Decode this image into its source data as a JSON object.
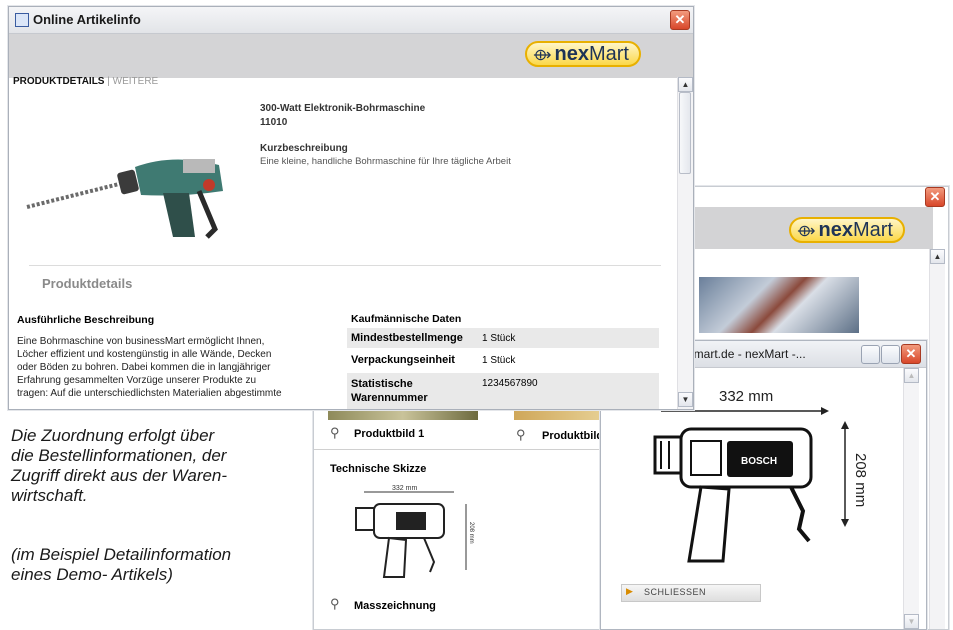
{
  "main_window": {
    "title": "Online Artikelinfo",
    "logo": {
      "bold": "nex",
      "rest": "Mart"
    },
    "tabs": {
      "active": "PRODUKTDETAILS",
      "separator": "|",
      "inactive": "WEITERE"
    },
    "product": {
      "name": "300-Watt Elektronik-Bohrmaschine",
      "number": "11010",
      "short_heading": "Kurzbeschreibung",
      "short_text": "Eine kleine, handliche Bohrmaschine für Ihre tägliche Arbeit"
    },
    "section_title": "Produktdetails",
    "description": {
      "heading": "Ausführliche Beschreibung",
      "lines": [
        "Eine Bohrmaschine von businessMart ermöglicht Ihnen,",
        "Löcher effizient und kostengünstig in alle Wände, Decken",
        "oder Böden zu bohren. Dabei kommen die in langjähriger",
        "Erfahrung gesammelten Vorzüge unserer Produkte zu",
        "tragen: Auf die unterschiedlichsten Materialien abgestimmte"
      ]
    },
    "commercial": {
      "heading": "Kaufmännische Daten",
      "rows": [
        {
          "label": "Mindestbestellmenge",
          "value": "1 Stück"
        },
        {
          "label": "Verpackungseinheit",
          "value": "1 Stück"
        },
        {
          "label": "Statistische Warennummer",
          "value": "1234567890"
        }
      ]
    }
  },
  "back_window": {
    "logo": {
      "bold": "nex",
      "rest": "Mart"
    },
    "image_labels": [
      "Produktbild 1",
      "Produktbild"
    ],
    "sketch_heading": "Technische Skizze",
    "sketch_dims": {
      "width": "332 mm",
      "height": "208 mm"
    },
    "sketch_caption": "Masszeichnung"
  },
  "popup_window": {
    "title": "w.nexmart.de - nexMart -...",
    "dim_width": "332 mm",
    "dim_height": "208 mm",
    "drill_label": "BOSCH",
    "close_button": "SCHLIESSEN"
  },
  "caption": {
    "lines": [
      "Die Zuordnung erfolgt über",
      "die Bestellinformationen, der",
      "Zugriff direkt aus der Waren-",
      "wirtschaft."
    ],
    "note_lines": [
      "(im Beispiel Detailinformation",
      "eines Demo- Artikels)"
    ]
  },
  "colors": {
    "logo_fill": "#fbd84a",
    "logo_text": "#1e3356",
    "close_red": "#d8472a",
    "table_shade": "#e9e9e9"
  }
}
